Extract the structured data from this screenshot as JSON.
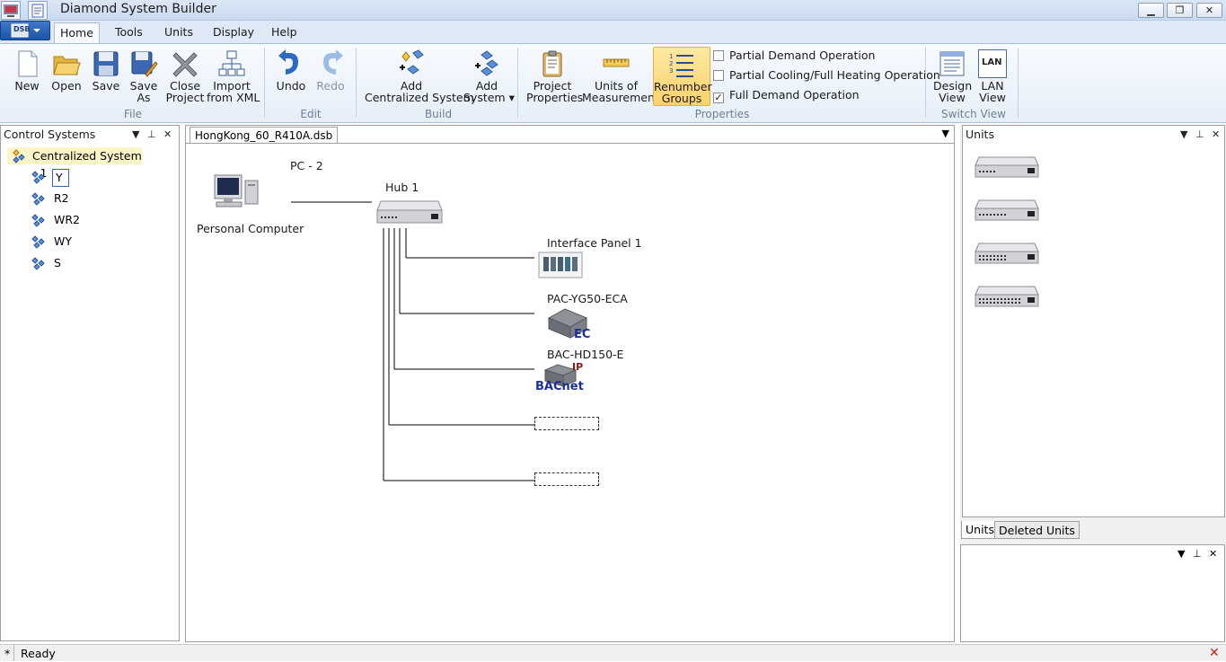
{
  "window": {
    "title": "Diamond System Builder",
    "controls": {
      "minimize": "▁",
      "restore": "❐",
      "close": "✕"
    }
  },
  "app_menu": {
    "label": "DSB"
  },
  "ribbon": {
    "tabs": [
      {
        "label": "Home",
        "active": true
      },
      {
        "label": "Tools"
      },
      {
        "label": "Units"
      },
      {
        "label": "Display"
      },
      {
        "label": "Help"
      }
    ],
    "groups": {
      "file": "File",
      "edit": "Edit",
      "build": "Build",
      "properties": "Properties",
      "switch_view": "Switch View"
    },
    "buttons": {
      "new": "New",
      "open": "Open",
      "save": "Save",
      "save_as_1": "Save",
      "save_as_2": "As",
      "close_project_1": "Close",
      "close_project_2": "Project",
      "import_xml_1": "Import",
      "import_xml_2": "from XML",
      "undo": "Undo",
      "redo": "Redo",
      "add_centralized_1": "Add",
      "add_centralized_2": "Centralized System",
      "add_system_1": "Add",
      "add_system_2": "System ▾",
      "project_properties_1": "Project",
      "project_properties_2": "Properties",
      "units_measurement_1": "Units of",
      "units_measurement_2": "Measurement",
      "renumber_groups_1": "Renumber",
      "renumber_groups_2": "Groups",
      "design_view_1": "Design",
      "design_view_2": "View",
      "lan_view_1": "LAN",
      "lan_view_2": "View"
    },
    "checkboxes": [
      {
        "label": "Partial Demand Operation",
        "checked": false
      },
      {
        "label": "Partial Cooling/Full Heating Operation",
        "checked": false
      },
      {
        "label": "Full Demand Operation",
        "checked": true
      }
    ],
    "check_mark": "✓",
    "lan_icon_text": "LAN"
  },
  "left_pane": {
    "title": "Control Systems",
    "root": "Centralized System - 1",
    "items": [
      "Y",
      "R2",
      "WR2",
      "WY",
      "S"
    ],
    "selected_index": 0
  },
  "pane_controls": {
    "dropdown": "▼",
    "pin": "⊥",
    "close": "✕"
  },
  "document": {
    "tab": "HongKong_60_R410A.dsb",
    "labels": {
      "pc_name": "PC - 2",
      "pc_caption": "Personal Computer",
      "hub": "Hub 1",
      "interface_panel": "Interface Panel 1",
      "pac": "PAC-YG50-ECA",
      "pac_badge": "EC",
      "bac": "BAC-HD150-E",
      "bac_badge": "IP",
      "bac_logo": "BACnet"
    }
  },
  "right_pane": {
    "title": "Units",
    "tabs": [
      "Units",
      "Deleted Units"
    ]
  },
  "status": {
    "indicator": "*",
    "text": "Ready",
    "close_icon": "✕"
  }
}
